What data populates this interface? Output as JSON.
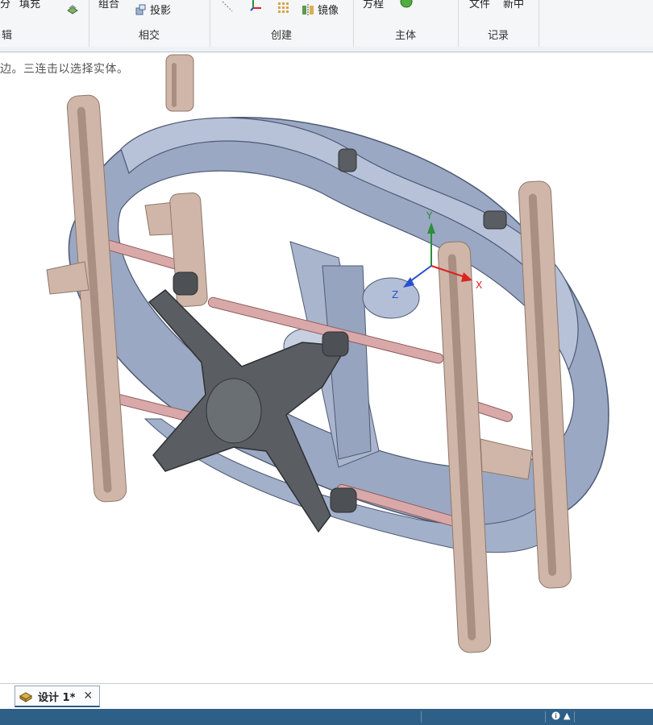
{
  "ribbon": {
    "groups": [
      {
        "label": "辑",
        "buttons": [
          "分",
          "填充"
        ]
      },
      {
        "label": "相交",
        "buttons": [
          "组合",
          "投影"
        ]
      },
      {
        "label": "创建",
        "buttons": [
          "镜像"
        ]
      },
      {
        "label": "主体",
        "buttons": [
          "方程"
        ]
      },
      {
        "label": "记录",
        "buttons": [
          "文件",
          "新中"
        ]
      }
    ]
  },
  "viewport": {
    "hint": "边。三连击以选择实体。",
    "triad": {
      "x_label": "X",
      "y_label": "Y",
      "z_label": "Z"
    }
  },
  "tabs": [
    {
      "label": "设计 1*",
      "close": "✕"
    }
  ],
  "statusbar": {
    "info_icon": "info-icon",
    "up_arrow": "▲"
  },
  "colors": {
    "ring": "#a9b5cd",
    "ring_dark": "#7f8eae",
    "bracket": "#cfb6a8",
    "bracket_dark": "#a88f82",
    "cross": "#5a5e62",
    "rod": "#d9a8a8",
    "statusbar": "#2e5f86"
  }
}
